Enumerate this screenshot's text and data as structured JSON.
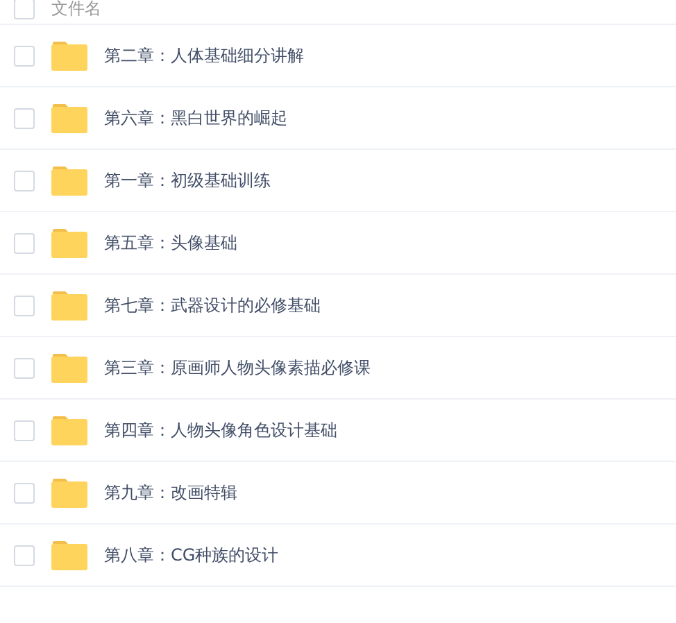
{
  "header": {
    "checked": false,
    "label": "文件名"
  },
  "files": [
    {
      "name": "第二章：人体基础细分讲解",
      "checked": false,
      "kind": "folder"
    },
    {
      "name": "第六章：黑白世界的崛起",
      "checked": false,
      "kind": "folder"
    },
    {
      "name": "第一章：初级基础训练",
      "checked": false,
      "kind": "folder"
    },
    {
      "name": "第五章：头像基础",
      "checked": false,
      "kind": "folder"
    },
    {
      "name": "第七章：武器设计的必修基础",
      "checked": false,
      "kind": "folder"
    },
    {
      "name": "第三章：原画师人物头像素描必修课",
      "checked": false,
      "kind": "folder"
    },
    {
      "name": "第四章：人物头像角色设计基础",
      "checked": false,
      "kind": "folder"
    },
    {
      "name": "第九章：改画特辑",
      "checked": false,
      "kind": "folder"
    },
    {
      "name": "第八章：CG种族的设计",
      "checked": false,
      "kind": "folder"
    }
  ]
}
